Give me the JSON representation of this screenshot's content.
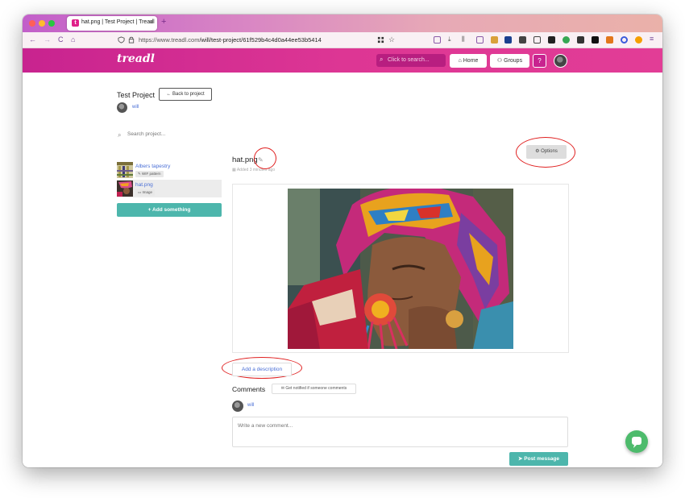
{
  "browser": {
    "tab_title": "hat.png | Test Project | Treadl",
    "tab_favicon": "t",
    "tab_close": "×",
    "new_tab": "+",
    "url_host": "https://www.treadl.com",
    "url_path": "/will/test-project/61f529b4c4d0a44ee53b5414",
    "nav": {
      "back": "←",
      "forward": "→",
      "reload": "C",
      "home": "⌂"
    }
  },
  "header": {
    "logo": "treadl",
    "search_placeholder": "Click to search...",
    "home_label": "Home",
    "groups_label": "Groups",
    "help_label": "?",
    "brand_color": "#dd3694"
  },
  "project": {
    "title": "Test Project",
    "back_label": "Back to project",
    "owner": "will"
  },
  "sidebar": {
    "search_placeholder": "Search project...",
    "items": [
      {
        "name": "Albers tapestry",
        "badge": "WIF pattern",
        "badge_icon": "pencil-icon"
      },
      {
        "name": "hat.png",
        "badge": "Image",
        "badge_icon": "image-icon"
      }
    ],
    "add_label": "Add something"
  },
  "file": {
    "title": "hat.png",
    "added": "Added 3 minutes ago",
    "options_label": "Options",
    "description_label": "Add a description"
  },
  "comments": {
    "heading": "Comments",
    "notify_label": "Get notified if someone comments",
    "user": "will",
    "placeholder": "Write a new comment...",
    "post_label": "Post message"
  },
  "colors": {
    "accent": "#4db6ac",
    "link": "#4a6fd6",
    "annotation": "#e02020"
  }
}
